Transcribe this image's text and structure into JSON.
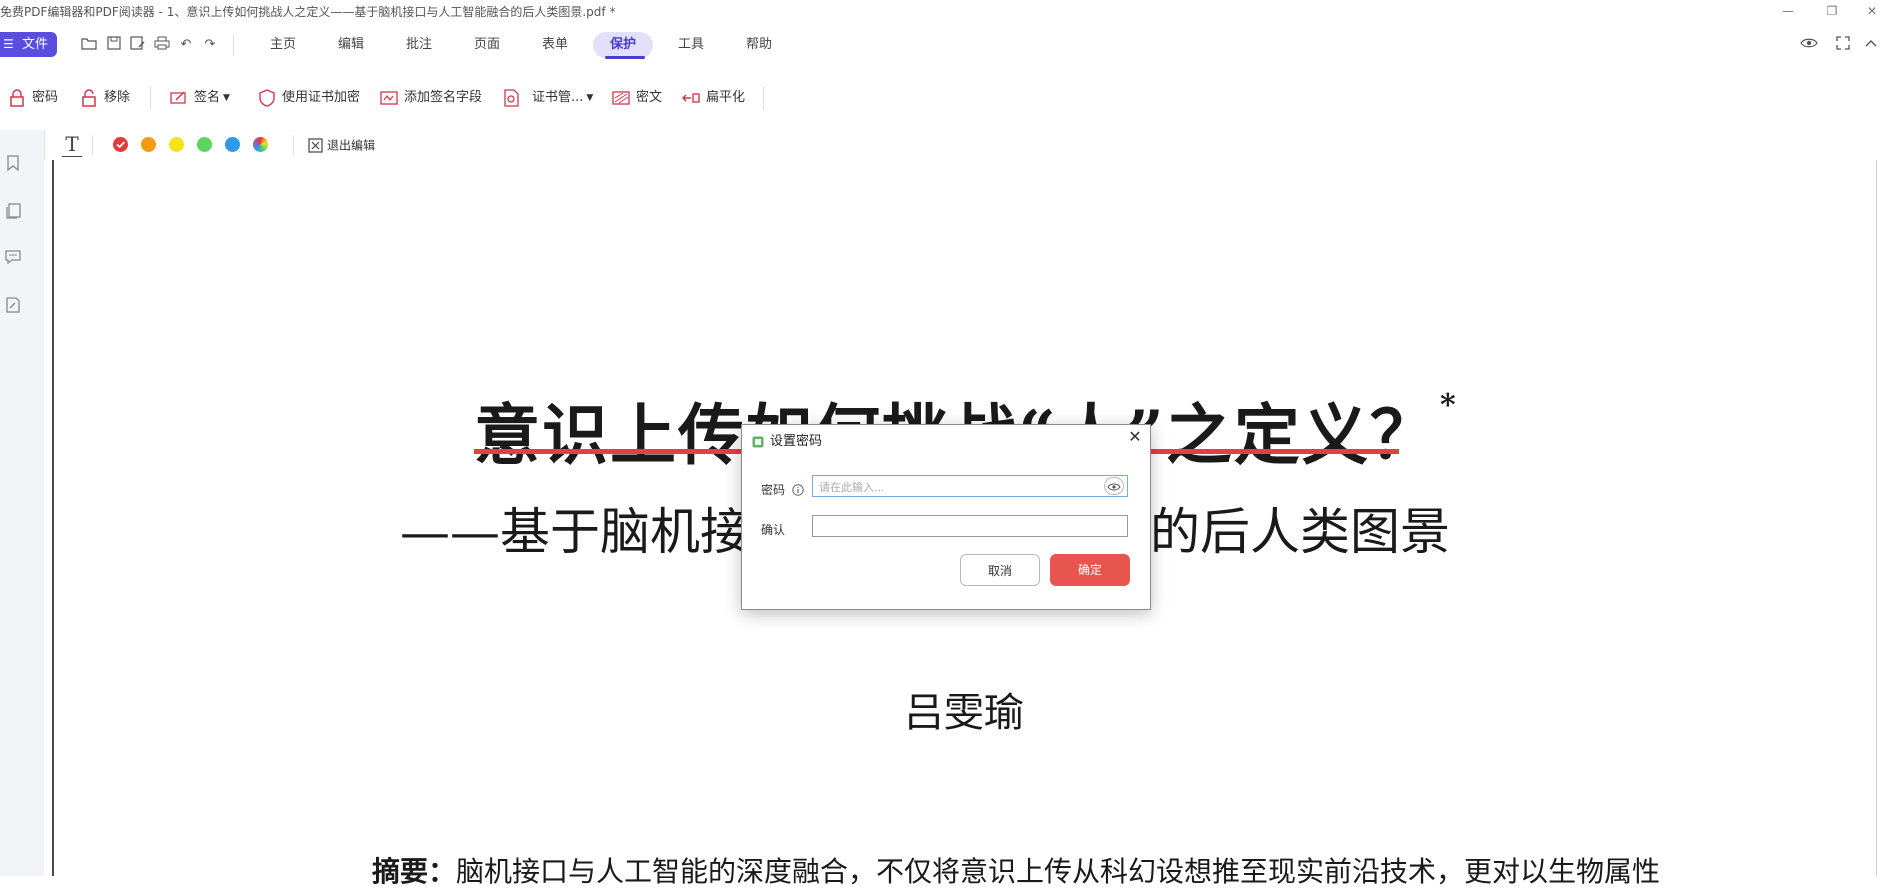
{
  "window": {
    "title": "免费PDF编辑器和PDF阅读器 - 1、意识上传如何挑战人之定义——基于脑机接口与人工智能融合的后人类图景.pdf *"
  },
  "menu": {
    "file_label": "文件",
    "tabs": [
      {
        "label": "主页"
      },
      {
        "label": "编辑"
      },
      {
        "label": "批注"
      },
      {
        "label": "页面"
      },
      {
        "label": "表单"
      },
      {
        "label": "保护",
        "active": true
      },
      {
        "label": "工具"
      },
      {
        "label": "帮助"
      }
    ]
  },
  "toolbar": {
    "password": "密码",
    "remove": "移除",
    "sign": "签名",
    "cert_encrypt": "使用证书加密",
    "add_sign_field": "添加签名字段",
    "cert_manage": "证书管...",
    "redact": "密文",
    "flatten": "扁平化"
  },
  "signbar": {
    "colors": [
      "#e53935",
      "#f39c12",
      "#f5e31c",
      "#5cd65c",
      "#2f9be8",
      "rainbow"
    ],
    "exit_edit": "退出编辑"
  },
  "document": {
    "title": "意识上传如何挑战“人”之定义？",
    "title_mark": "*",
    "subtitle": "——基于脑机接口与人工智能融合的后人类图景",
    "author": "吕雯瑜",
    "abstract_label": "摘要：",
    "abstract_text": "脑机接口与人工智能的深度融合，不仅将意识上传从科幻设想推至现实前沿技术，更对以生物属性"
  },
  "dialog": {
    "title": "设置密码",
    "password_label": "密码",
    "password_placeholder": "请在此输入...",
    "password_value": "",
    "confirm_label": "确认",
    "confirm_value": "",
    "cancel_label": "取消",
    "ok_label": "确定"
  }
}
